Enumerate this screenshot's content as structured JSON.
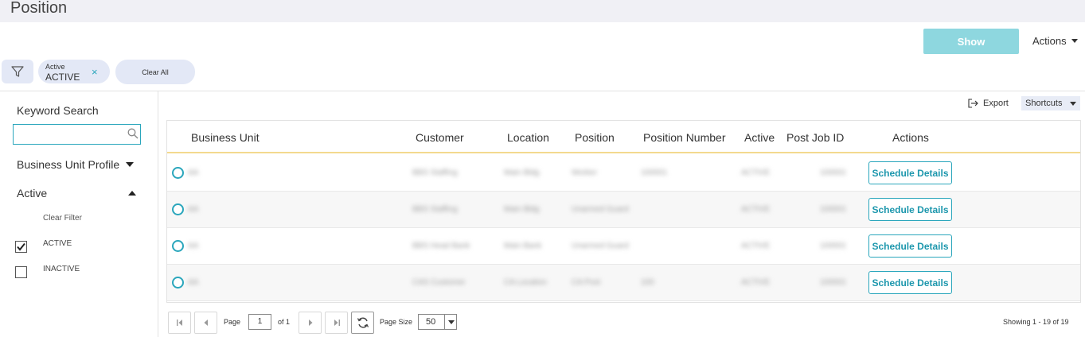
{
  "header": {
    "title": "Position"
  },
  "toolbar": {
    "show_label": "Show",
    "actions_label": "Actions"
  },
  "filters": {
    "chip": {
      "label": "Active",
      "value": "ACTIVE",
      "remove": "×"
    },
    "clear_all": "Clear All"
  },
  "sidebar": {
    "keyword_label": "Keyword Search",
    "keyword_value": "",
    "business_unit_profile": "Business Unit Profile",
    "active_facet": "Active",
    "clear_filter": "Clear Filter",
    "options": [
      {
        "label": "ACTIVE",
        "checked": true
      },
      {
        "label": "INACTIVE",
        "checked": false
      }
    ]
  },
  "grid_toolbar": {
    "export_label": "Export",
    "shortcuts_label": "Shortcuts"
  },
  "grid": {
    "columns": [
      "Business Unit",
      "Customer",
      "Location",
      "Position",
      "Position Number",
      "Active",
      "Post Job ID",
      "Actions"
    ],
    "rows": [
      {
        "business_unit": "AA",
        "customer": "BBS Staffing",
        "location": "Main Bldg",
        "position": "Worker",
        "number": "100001",
        "active": "ACTIVE",
        "job_id": "100001",
        "action": "Schedule Details"
      },
      {
        "business_unit": "AA",
        "customer": "BBS Staffing",
        "location": "Main Bldg",
        "position": "Unarmed Guard",
        "number": "100001",
        "active": "ACTIVE",
        "job_id": "100001",
        "action": "Schedule Details"
      },
      {
        "business_unit": "AA",
        "customer": "BBS Head Bank",
        "location": "Main Bank",
        "position": "Unarmed Guard",
        "number": "100001",
        "active": "ACTIVE",
        "job_id": "100001",
        "action": "Schedule Details"
      },
      {
        "business_unit": "AA",
        "customer": "CAS Customer",
        "location": "CA Location",
        "position": "CA Post",
        "number": "100",
        "active": "ACTIVE",
        "job_id": "100001",
        "action": "Schedule Details"
      }
    ]
  },
  "pager": {
    "page_label": "Page",
    "page_value": "1",
    "of_label": "of 1",
    "page_size_label": "Page Size",
    "page_size_value": "50",
    "showing": "Showing 1 - 19 of 19"
  },
  "colors": {
    "accent": "#2aa6bc",
    "show_button": "#8ed7df",
    "chip_bg": "#e3e8f6",
    "header_underline": "#f3d98e"
  }
}
